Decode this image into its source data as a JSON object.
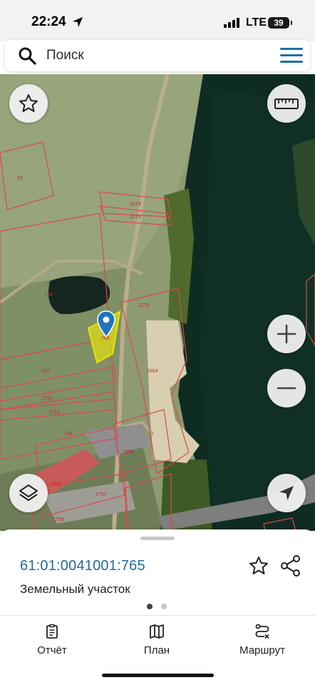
{
  "status_bar": {
    "time": "22:24",
    "network": "LTE",
    "battery": "39"
  },
  "search": {
    "placeholder": "Поиск",
    "value": ""
  },
  "map": {
    "parcel_labels": [
      "37",
      "2273",
      "2274",
      "738",
      "2275",
      "765",
      "737",
      "1604",
      "1711",
      "1712",
      "742",
      "1996",
      "1511",
      "1757",
      "1758"
    ],
    "selected_parcel_color": "#f2f200"
  },
  "sheet": {
    "cadastral_number": "61:01:0041001:765",
    "parcel_type": "Земельный участок",
    "page_count": 2,
    "active_page": 1
  },
  "nav": {
    "report_label": "Отчёт",
    "plan_label": "План",
    "route_label": "Маршрут"
  },
  "colors": {
    "accent": "#1f6aa0",
    "boundary": "#d94a4a",
    "water": "#0e2a21"
  },
  "icons": [
    "search-icon",
    "menu-icon",
    "star-icon",
    "ruler-icon",
    "plus-icon",
    "minus-icon",
    "layers-icon",
    "navigation-arrow-icon",
    "map-pin-icon",
    "share-icon",
    "report-icon",
    "map-icon",
    "route-icon"
  ]
}
